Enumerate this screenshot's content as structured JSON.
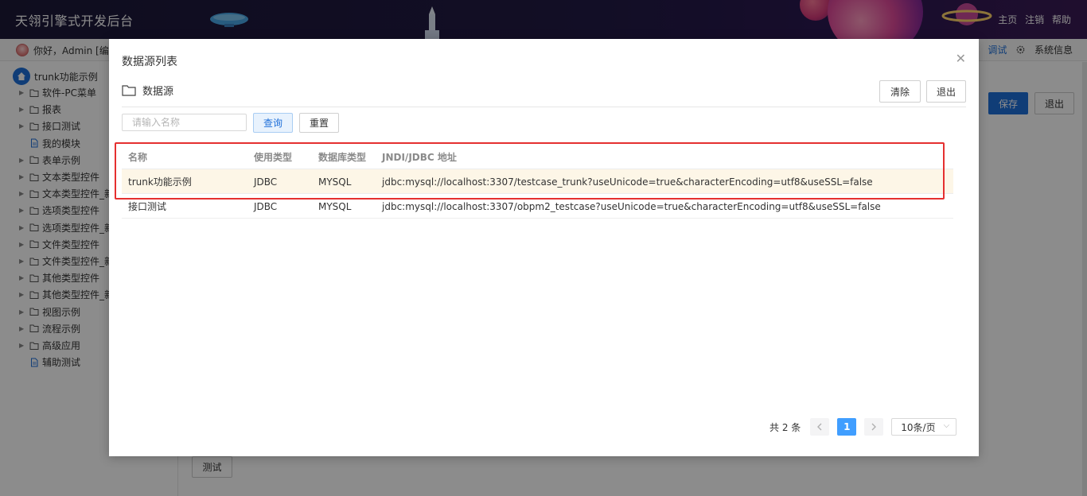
{
  "header": {
    "app_title": "天翎引擎式开发后台",
    "links": [
      "主页",
      "注销",
      "帮助"
    ]
  },
  "subbar": {
    "greeting": "你好，Admin [编辑",
    "debug": "调试",
    "system_info": "系统信息"
  },
  "sidebar": {
    "root": "trunk功能示例",
    "items": [
      {
        "label": "软件-PC菜单",
        "type": "folder"
      },
      {
        "label": "报表",
        "type": "folder"
      },
      {
        "label": "接口测试",
        "type": "folder"
      },
      {
        "label": "我的模块",
        "type": "file"
      },
      {
        "label": "表单示例",
        "type": "folder"
      },
      {
        "label": "文本类型控件",
        "type": "folder"
      },
      {
        "label": "文本类型控件_新",
        "type": "folder"
      },
      {
        "label": "选项类型控件",
        "type": "folder"
      },
      {
        "label": "选项类型控件_新",
        "type": "folder"
      },
      {
        "label": "文件类型控件",
        "type": "folder"
      },
      {
        "label": "文件类型控件_新",
        "type": "folder"
      },
      {
        "label": "其他类型控件",
        "type": "folder"
      },
      {
        "label": "其他类型控件_新",
        "type": "folder"
      },
      {
        "label": "视图示例",
        "type": "folder"
      },
      {
        "label": "流程示例",
        "type": "folder"
      },
      {
        "label": "高级应用",
        "type": "folder"
      },
      {
        "label": "辅助测试",
        "type": "file"
      }
    ]
  },
  "background": {
    "save_label": "保存",
    "exit_label": "退出",
    "test_label": "测试"
  },
  "modal": {
    "title": "数据源列表",
    "section_title": "数据源",
    "clear_label": "清除",
    "exit_label": "退出",
    "search_placeholder": "请输入名称",
    "query_label": "查询",
    "reset_label": "重置",
    "columns": [
      "名称",
      "使用类型",
      "数据库类型",
      "JNDI/JDBC 地址"
    ],
    "rows": [
      {
        "name": "trunk功能示例",
        "use_type": "JDBC",
        "db_type": "MYSQL",
        "url": "jdbc:mysql://localhost:3307/testcase_trunk?useUnicode=true&characterEncoding=utf8&useSSL=false"
      },
      {
        "name": "接口测试",
        "use_type": "JDBC",
        "db_type": "MYSQL",
        "url": "jdbc:mysql://localhost:3307/obpm2_testcase?useUnicode=true&characterEncoding=utf8&useSSL=false"
      }
    ],
    "pagination": {
      "total": "共 2 条",
      "current_page": "1",
      "page_size": "10条/页"
    }
  },
  "colors": {
    "accent": "#409eff",
    "primary_button": "#1e6fd9",
    "highlight_box": "#e53030",
    "selected_row": "#fdf6e7"
  }
}
